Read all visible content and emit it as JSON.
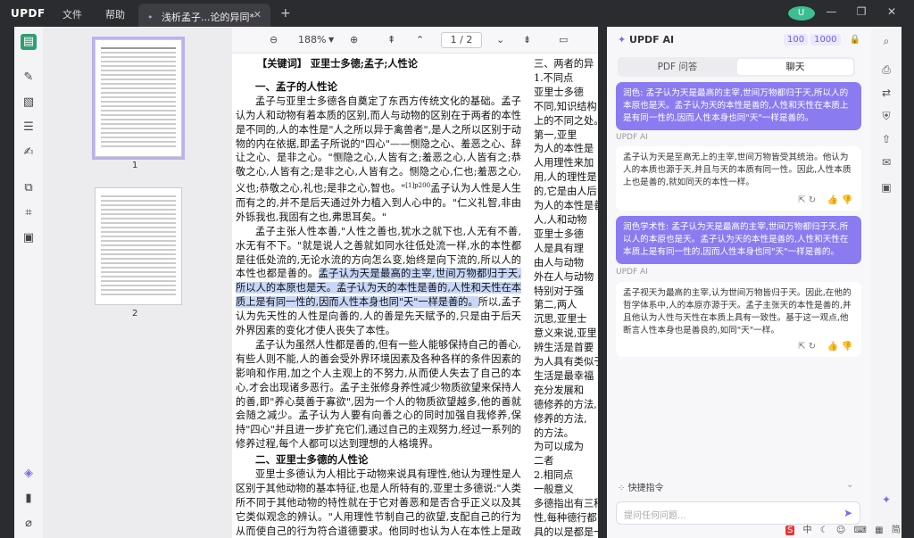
{
  "app": {
    "logo": "UPDF",
    "menu_file": "文件",
    "menu_help": "帮助",
    "tab_title": "浅析孟子...论的异同*",
    "tab_dot": "•",
    "avatar": "U"
  },
  "toolbar": {
    "zoom": "188%",
    "page_current": "1",
    "page_sep": "/",
    "page_total": "2"
  },
  "thumbs": {
    "page1": "1",
    "page2": "2"
  },
  "document": {
    "keywords": "【关键词】 亚里士多德;孟子;人性论",
    "h1": "一、孟子的人性论",
    "p1": "孟子与亚里士多德各自奠定了东西方传统文化的基础。孟子认为人和动物有着本质的区别,而人与动物的区别在于两者的本性是不同的,人的本性是\"人之所以异于禽兽者\",是人之所以区别于动物的内在依据,即孟子所说的\"四心\"——恻隐之心、羞恶之心、辞让之心、是非之心。\"恻隐之心,人皆有之;羞恶之心,人皆有之;恭敬之心,人皆有之;是非之心,人皆有之。恻隐之心,仁也;羞恶之心,义也;恭敬之心,礼也;是非之心,智也。\"",
    "cite": "[1]p200",
    "p1b": "孟子认为人性是人生而有之的,并不是后天通过外力植入到人心中的。\"仁义礼智,非由外铄我也,我固有之也,弗思耳矣。\"",
    "p2a": "孟子主张人性本善,\"人性之善也,犹水之就下也,人无有不善,水无有不下。\"就是说人之善就如同水往低处流一样,水的本性都是往低处流的,无论水流的方向怎么变,始终是向下流的,所以人的本性也都是善的。",
    "p2hl": "孟子认为天是最高的主宰,世间万物都归于天,所以人的本原也是天。孟子认为天的本性是善的,人性和天性在本质上是有同一性的,因而人性本身也同\"天\"一样是善的。",
    "p2b": "所以,孟子认为先天性的人性是向善的,人的善是先天赋予的,只是由于后天外界因素的变化才使人丧失了本性。",
    "p3": "孟子认为虽然人性都是善的,但有一些人能够保持自己的善心,有些人则不能,人的善会受外界环境因素及各种各样的条件因素的影响和作用,加之个人主观上的不努力,从而使人失去了自己的本心,才会出现诸多恶行。孟子主张修身养性减少物质欲望来保持人的善,即\"养心莫善于寡欲\",因为一个人的物质欲望越多,他的善就会随之减少。孟子认为人要有向善之心的同时加强自我修养,保持\"四心\"并且进一步扩充它们,通过自己的主观努力,经过一系列的修养过程,每个人都可以达到理想的人格境界。",
    "h2": "二、亚里士多德的人性论",
    "p4": "亚里士多德认为人相比于动物来说具有理性,他认为理性是人区别于其他动物的基本特征,也是人所特有的,亚里士多德说:\"人类所不同于其他动物的特性就在于它对善恶和是否合乎正义以及其它类似观念的辨认。\"人用理性节制自己的欲望,支配自己的行为从而使自己的行为符合道德要求。他同时也认为人在本性上是政治动物,人类结成政治共同体,居住在城邦之中,个人和城邦之中",
    "col2": [
      "三、两者的异",
      "1.不同点",
      "亚里士多德",
      "不同,知识结构",
      "上的不同之处。",
      "第一,亚里",
      "为人的本性是",
      "人用理性来加",
      "用,人的理性是",
      "的,它是由人后",
      "为人的本性是善",
      "人,人和动物",
      "亚里士多德",
      "人是具有理",
      "由人与动物",
      "外在人与动物",
      "特别对于强",
      "第二,两人",
      "沉思,亚里士",
      "意义来说,亚里",
      "辨生活是首要",
      "为人具有类似于",
      "生活是最幸福",
      "充分发展和",
      "德修养的方法,",
      "修养的方法,",
      "的方法。",
      "为可以成为",
      "二者",
      "2.相同点",
      "一般意义",
      "多德指出有三种",
      "性,每种德行都",
      "具的以是都是一种",
      "亚里士多"
    ]
  },
  "ai": {
    "title": "UPDF AI",
    "credit1": "100",
    "credit2": "1000",
    "tab_pdf": "PDF 问答",
    "tab_chat": "聊天",
    "msg1": "润色: 孟子认为天是最高的主宰,世间万物都归于天,所以人的本原也是天。孟子认为天的本性是善的,人性和天性在本质上是有同一性的,因而人性本身也同\"天\"一样是善的。",
    "label1": "UPDF AI",
    "resp1": "孟子认为天是至高无上的主宰,世间万物皆受其统治。他认为人的本质也源于天,并且与天的本质有同一性。因此,人性本质上也是善的,就如同天的本性一样。",
    "msg2": "润色学术性: 孟子认为天是最高的主宰,世间万物都归于天,所以人的本原也是天。孟子认为天的本性是善的,人性和天性在本质上是有同一性的,因而人性本身也同\"天\"一样是善的。",
    "label2": "UPDF AI",
    "resp2": "孟子视天为最高的主宰,认为世间万物皆归于天。因此,在他的哲学体系中,人的本原亦源于天。孟子主张天的本性是善的,并且他认为人性与天性在本质上具有一致性。基于这一观点,他断言人性本身也是善良的,如同\"天\"一样。",
    "quick_cmd": "快捷指令",
    "input_placeholder": "提问任何问题..."
  },
  "tray": {
    "ime": "中",
    "lang": "简"
  }
}
